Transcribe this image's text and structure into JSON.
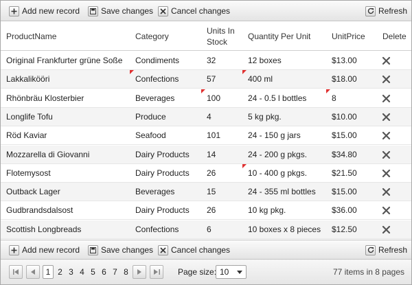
{
  "toolbar": {
    "add_label": "Add new record",
    "save_label": "Save changes",
    "cancel_label": "Cancel changes",
    "refresh_label": "Refresh"
  },
  "columns": [
    "ProductName",
    "Category",
    "Units In Stock",
    "Quantity Per Unit",
    "UnitPrice",
    "Delete"
  ],
  "columns_lines": {
    "units_1": "Units In",
    "units_2": "Stock"
  },
  "rows": [
    {
      "name": "Original Frankfurter grüne Soße",
      "category": "Condiments",
      "units": "32",
      "qty": "12 boxes",
      "price": "$13.00"
    },
    {
      "name": "Lakkalikööri",
      "category": "Confections",
      "units": "57",
      "qty": "400 ml",
      "price": "$18.00"
    },
    {
      "name": "Rhönbräu Klosterbier",
      "category": "Beverages",
      "units": "100",
      "qty": "24 - 0.5 l bottles",
      "price": "8"
    },
    {
      "name": "Longlife Tofu",
      "category": "Produce",
      "units": "4",
      "qty": "5 kg pkg.",
      "price": "$10.00"
    },
    {
      "name": "Röd Kaviar",
      "category": "Seafood",
      "units": "101",
      "qty": "24 - 150 g jars",
      "price": "$15.00"
    },
    {
      "name": "Mozzarella di Giovanni",
      "category": "Dairy Products",
      "units": "14",
      "qty": "24 - 200 g pkgs.",
      "price": "$34.80"
    },
    {
      "name": "Flotemysost",
      "category": "Dairy Products",
      "units": "26",
      "qty": "10 - 400 g pkgs.",
      "price": "$21.50"
    },
    {
      "name": "Outback Lager",
      "category": "Beverages",
      "units": "15",
      "qty": "24 - 355 ml bottles",
      "price": "$15.00"
    },
    {
      "name": "Gudbrandsdalsost",
      "category": "Dairy Products",
      "units": "26",
      "qty": "10 kg pkg.",
      "price": "$36.00"
    },
    {
      "name": "Scottish Longbreads",
      "category": "Confections",
      "units": "6",
      "qty": "10 boxes x 8 pieces",
      "price": "$12.50"
    }
  ],
  "pager": {
    "pages": [
      "1",
      "2",
      "3",
      "4",
      "5",
      "6",
      "7",
      "8"
    ],
    "current": "1",
    "page_size_label": "Page size:",
    "page_size": "10",
    "info": "77 items in 8 pages"
  },
  "colors": {
    "dirty_marker": "#e03030",
    "alt_row": "#f4f4f4"
  }
}
